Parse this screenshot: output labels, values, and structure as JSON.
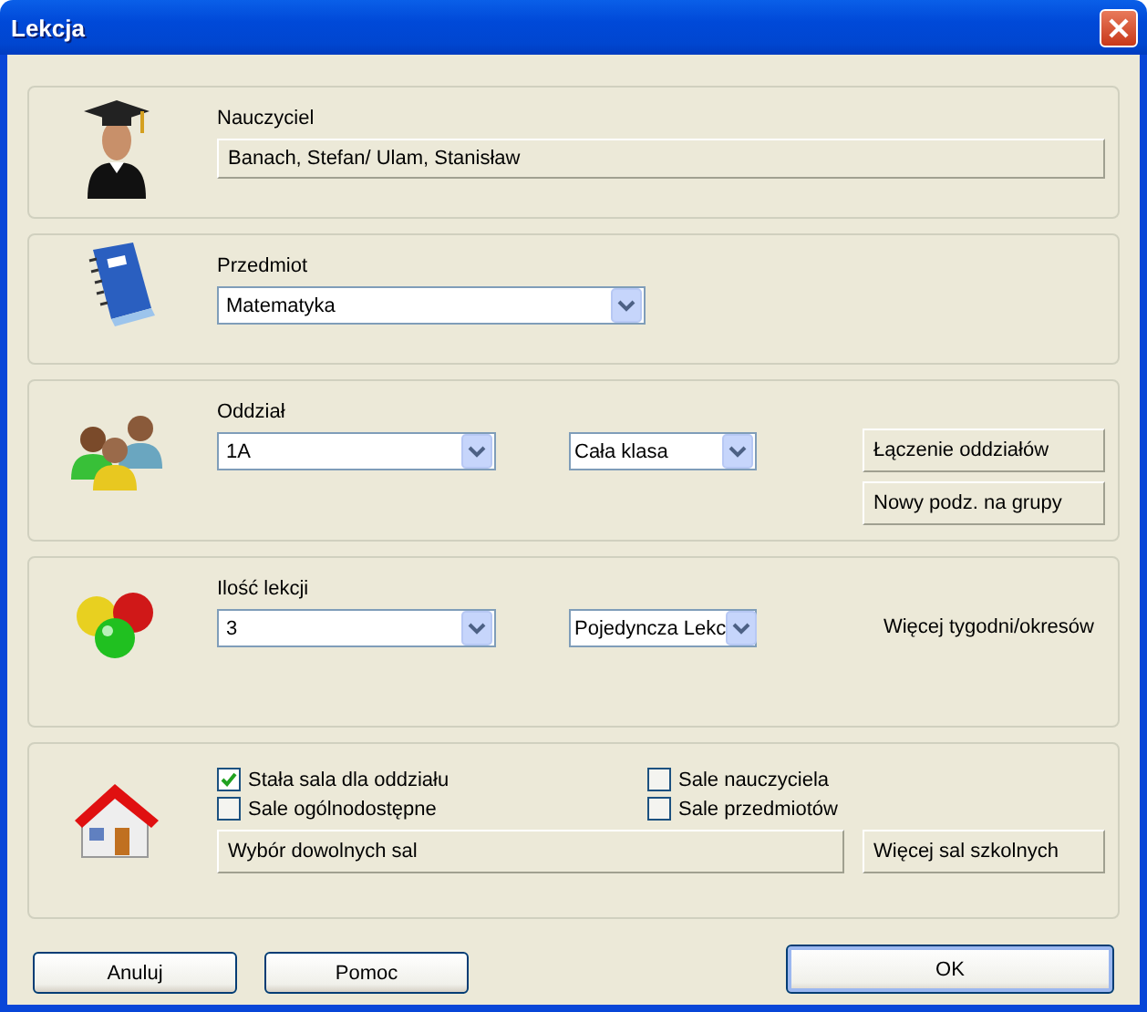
{
  "window": {
    "title": "Lekcja"
  },
  "teacher": {
    "label": "Nauczyciel",
    "value": "Banach, Stefan/ Ulam, Stanisław"
  },
  "subject": {
    "label": "Przedmiot",
    "value": "Matematyka"
  },
  "class": {
    "label": "Oddział",
    "value": "1A",
    "group": "Cała klasa",
    "buttons": [
      "Łączenie oddziałów",
      "Nowy podz. na grupy"
    ]
  },
  "lessons": {
    "label": "Ilość lekcji",
    "value": "3",
    "type": "Pojedyncza Lekc",
    "link": "Więcej tygodni/okresów"
  },
  "rooms": {
    "checkboxes": [
      {
        "label": "Stała sala dla oddziału",
        "checked": true
      },
      {
        "label": "Sale nauczyciela",
        "checked": false
      },
      {
        "label": "Sale ogólnodostępne",
        "checked": false
      },
      {
        "label": "Sale przedmiotów",
        "checked": false
      }
    ],
    "choose_button": "Wybór dowolnych sal",
    "more_button": "Więcej sal szkolnych"
  },
  "buttons": [
    {
      "label": "Anuluj",
      "kind": "normal"
    },
    {
      "label": "Pomoc",
      "kind": "normal"
    },
    {
      "label": "OK",
      "kind": "default"
    }
  ]
}
